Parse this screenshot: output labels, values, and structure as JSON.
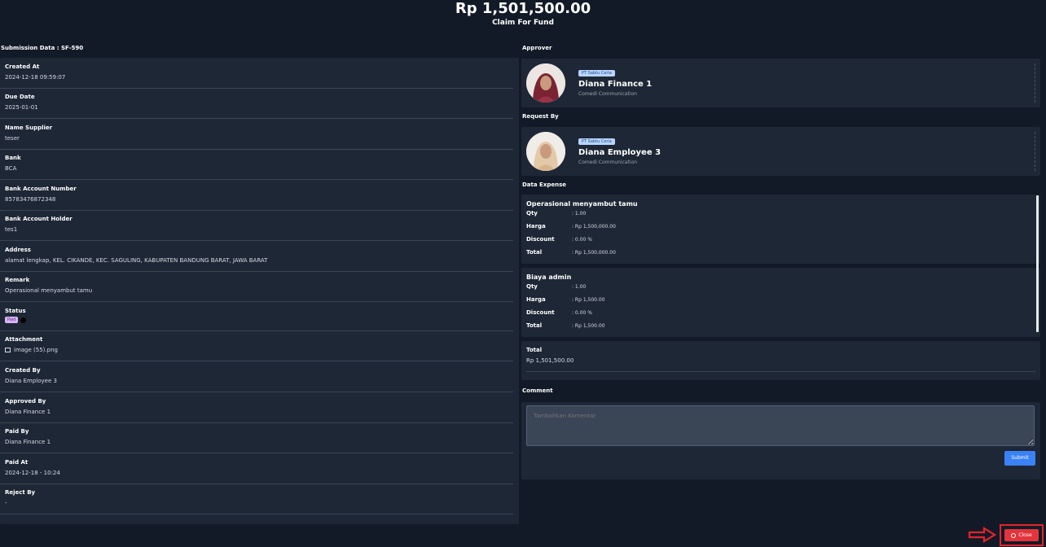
{
  "header": {
    "amount": "Rp 1,501,500.00",
    "subtitle": "Claim For Fund"
  },
  "submission": {
    "label": "Submission Data : SF-590",
    "fields": [
      {
        "label": "Created At",
        "value": "2024-12-18 09:59:07"
      },
      {
        "label": "Due Date",
        "value": "2025-01-01"
      },
      {
        "label": "Name Supplier",
        "value": "teser"
      },
      {
        "label": "Bank",
        "value": "BCA"
      },
      {
        "label": "Bank Account Number",
        "value": "85783476872348"
      },
      {
        "label": "Bank Account Holder",
        "value": "tes1"
      },
      {
        "label": "Address",
        "value": "alamat lengkap, KEL. CIKANDE, KEC. SAGULING, KABUPATEN BANDUNG BARAT, JAWA BARAT"
      },
      {
        "label": "Remark",
        "value": "Operasional menyambut tamu"
      },
      {
        "label": "Status",
        "value": "Paid"
      },
      {
        "label": "Attachment",
        "value": "image (55).png"
      },
      {
        "label": "Created By",
        "value": "Diana Employee 3"
      },
      {
        "label": "Approved By",
        "value": "Diana Finance 1"
      },
      {
        "label": "Paid By",
        "value": "Diana Finance 1"
      },
      {
        "label": "Paid At",
        "value": "2024-12-18 - 10:24"
      },
      {
        "label": "Reject By",
        "value": "-"
      }
    ]
  },
  "approver": {
    "label": "Approver",
    "company": "PT Sabtu Ceria",
    "name": "Diana Finance 1",
    "org": "Comedi Communication"
  },
  "requester": {
    "label": "Request By",
    "company": "PT Sabtu Ceria",
    "name": "Diana Employee 3",
    "org": "Comedi Communication"
  },
  "expense": {
    "label": "Data Expense",
    "keys": {
      "qty": "Qty",
      "harga": "Harga",
      "discount": "Discount",
      "total": "Total"
    },
    "items": [
      {
        "title": "Operasional menyambut tamu",
        "qty": ": 1.00",
        "harga": ": Rp 1,500,000.00",
        "discount": ": 0.00 %",
        "total": ": Rp 1,500,000.00"
      },
      {
        "title": "Biaya admin",
        "qty": ": 1.00",
        "harga": ": Rp 1,500.00",
        "discount": ": 0.00 %",
        "total": ": Rp 1,500.00"
      }
    ],
    "total_label": "Total",
    "total_value": "Rp 1,501,500.00"
  },
  "comment": {
    "label": "Comment",
    "placeholder": "Tambahkan Komentar",
    "submit_label": "Submit"
  },
  "footer": {
    "close_label": "Close"
  },
  "colors": {
    "accent": "#3b82f6",
    "danger": "#e3343b",
    "background": "#131a27",
    "panel": "#1e2736"
  }
}
